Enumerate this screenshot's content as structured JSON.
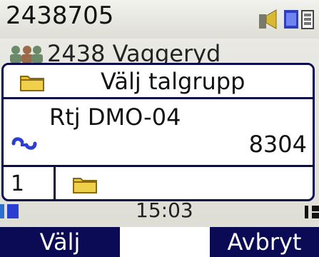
{
  "status": {
    "number": "2438705"
  },
  "group": {
    "label": "2438 Vaggeryd"
  },
  "dialog": {
    "title": "Välj talgrupp",
    "talkgroup_name": "Rtj DMO-04",
    "talkgroup_id": "8304",
    "index": "1"
  },
  "clock": "15:03",
  "softkeys": {
    "left": "Välj",
    "right": "Avbryt"
  },
  "colors": {
    "accent_dark": "#0a0a55",
    "folder_yellow": "#e9c43a",
    "link_blue": "#2a3ed0"
  },
  "icons": [
    "network-icon",
    "signal-icon",
    "battery-icon",
    "users-icon",
    "folder-icon",
    "link-icon"
  ]
}
